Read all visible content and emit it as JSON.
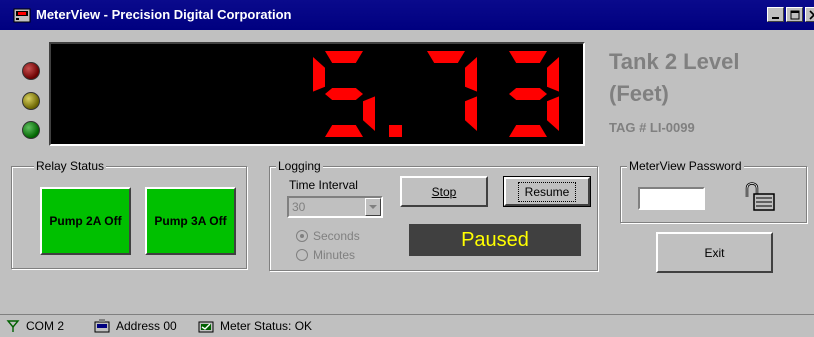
{
  "window": {
    "title": "MeterView - Precision Digital Corporation",
    "icon": "meter-app-icon",
    "controls": [
      "minimize-icon",
      "maximize-icon",
      "close-icon"
    ]
  },
  "indicators": [
    {
      "name": "red-alarm-led",
      "color": "#6a0000"
    },
    {
      "name": "yellow-alarm-led",
      "color": "#6a6400"
    },
    {
      "name": "green-ok-led",
      "color": "#006400"
    }
  ],
  "display": {
    "reading": "5.73",
    "digit_color": "#ff0000",
    "background": "#000000"
  },
  "tag": {
    "title": "Tank 2 Level",
    "subtitle": "(Feet)",
    "id": "TAG # LI-0099"
  },
  "relay": {
    "label": "Relay Status",
    "buttons": [
      {
        "label": "Pump 2A Off",
        "color": "#00c000"
      },
      {
        "label": "Pump 3A Off",
        "color": "#00c000"
      }
    ]
  },
  "logging": {
    "label": "Logging",
    "interval_label": "Time Interval",
    "interval_value": "30",
    "options": [
      "Seconds",
      "Minutes"
    ],
    "selected_option": "Seconds",
    "stop_label": "Stop",
    "resume_label": "Resume",
    "state": "Paused",
    "state_color": "#ffff00"
  },
  "password": {
    "label": "MeterView Password",
    "value": "",
    "icon": "padlock-icon"
  },
  "exit_label": "Exit",
  "statusbar": {
    "port": "COM 2",
    "address": "Address 00",
    "meter_status": "Meter Status: OK"
  }
}
